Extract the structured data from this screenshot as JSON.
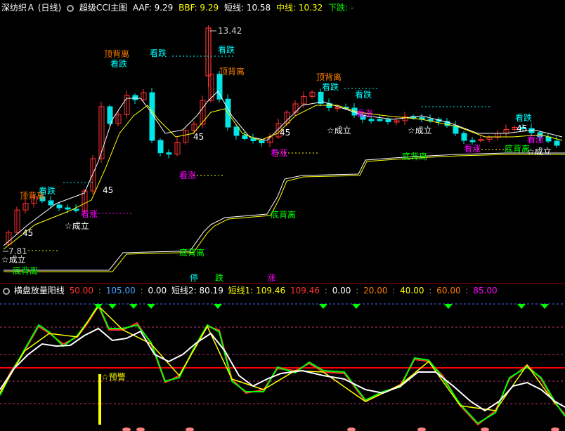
{
  "topbar": {
    "title": "深纺织Ａ (日线)",
    "indicator": "超级CCI主图",
    "aaf": "AAF: 9.29",
    "bbf": "BBF: 9.29",
    "short_line": "短线: 10.58",
    "mid_line": "中线: 10.32",
    "down": "下跌: -"
  },
  "main_labels": {
    "high_price": "13.42",
    "low_price": "7.81",
    "top_divergence": "顶背离",
    "bottom_divergence": "底背离",
    "look_down": "看跌",
    "look_up": "看涨",
    "established": "☆成立",
    "forty_five": "45",
    "stop": "停",
    "fall": "跌",
    "rise": "涨"
  },
  "subbar": {
    "name": "横盘放量阳线",
    "v1": "50.00",
    "v2": "105.00",
    "v3": "0.00",
    "short2": "短线2: 80.19",
    "short1": "短线1: 109.46",
    "v4": "109.46",
    "v5": "0.00",
    "v6": "20.00",
    "v7": "40.00",
    "v8": "60.00",
    "v9": "85.00"
  },
  "sub_labels": {
    "warning": "☆预警"
  },
  "colors": {
    "up": "#ff3232",
    "down": "#00e5e5",
    "yellow": "#ffff00",
    "green": "#00ff00",
    "magenta": "#ff00ff",
    "orange": "#ff7f00",
    "cyan": "#00ffff"
  }
}
